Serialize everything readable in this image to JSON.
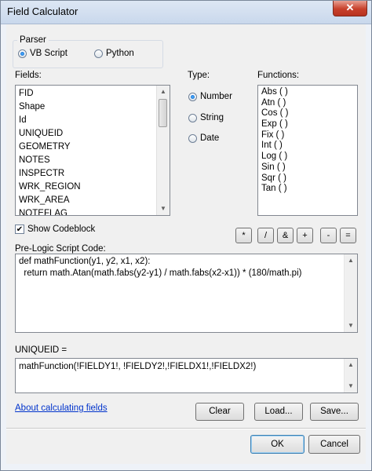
{
  "window": {
    "title": "Field Calculator",
    "close_glyph": "✕"
  },
  "parser": {
    "label": "Parser",
    "options": [
      {
        "label": "VB Script",
        "selected": true
      },
      {
        "label": "Python",
        "selected": false
      }
    ]
  },
  "fields": {
    "label": "Fields:",
    "items": [
      "FID",
      "Shape",
      "Id",
      "UNIQUEID",
      "GEOMETRY",
      "NOTES",
      "INSPECTR",
      "WRK_REGION",
      "WRK_AREA",
      "NOTEFLAG"
    ]
  },
  "type": {
    "label": "Type:",
    "options": [
      {
        "label": "Number",
        "selected": true
      },
      {
        "label": "String",
        "selected": false
      },
      {
        "label": "Date",
        "selected": false
      }
    ]
  },
  "functions": {
    "label": "Functions:",
    "items": [
      "Abs (  )",
      "Atn (  )",
      "Cos (  )",
      "Exp (  )",
      "Fix (  )",
      "Int (  )",
      "Log (  )",
      "Sin (  )",
      "Sqr (  )",
      "Tan (  )"
    ]
  },
  "show_codeblock": {
    "label": "Show Codeblock",
    "checked": true
  },
  "operators": [
    "*",
    "/",
    "&",
    "+",
    "-",
    "="
  ],
  "prelogic": {
    "label": "Pre-Logic Script Code:",
    "lines": [
      "def mathFunction(y1, y2, x1, x2):",
      "  return math.Atan(math.fabs(y2-y1) / math.fabs(x2-x1)) * (180/math.pi)"
    ]
  },
  "expression": {
    "label": "UNIQUEID =",
    "value": "mathFunction(!FIELDY1!, !FIELDY2!,!FIELDX1!,!FIELDX2!)"
  },
  "link": {
    "label": "About calculating fields"
  },
  "buttons": {
    "clear": "Clear",
    "load": "Load...",
    "save": "Save...",
    "ok": "OK",
    "cancel": "Cancel"
  }
}
